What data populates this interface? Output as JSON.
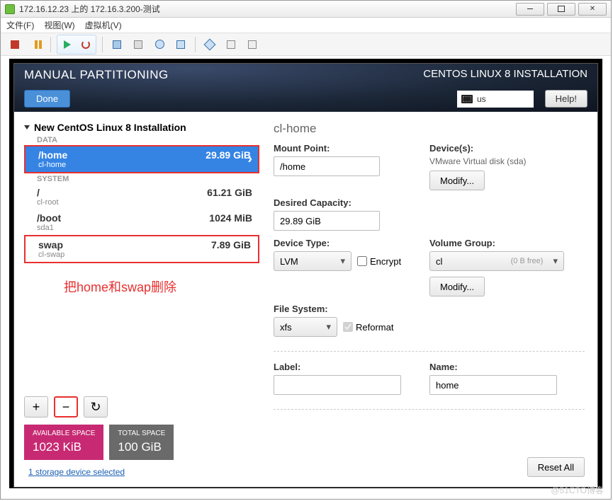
{
  "window": {
    "title": "172.16.12.23 上的 172.16.3.200-测试"
  },
  "menu": {
    "file": "文件(F)",
    "view": "视图(W)",
    "vm": "虚拟机(V)"
  },
  "installer": {
    "title": "MANUAL PARTITIONING",
    "product": "CENTOS LINUX 8 INSTALLATION",
    "done": "Done",
    "help": "Help!",
    "kb": "us"
  },
  "tree": {
    "header": "New CentOS Linux 8 Installation",
    "data_label": "DATA",
    "system_label": "SYSTEM",
    "home": {
      "mp": "/home",
      "size": "29.89 GiB",
      "dev": "cl-home"
    },
    "root": {
      "mp": "/",
      "size": "61.21 GiB",
      "dev": "cl-root"
    },
    "boot": {
      "mp": "/boot",
      "size": "1024 MiB",
      "dev": "sda1"
    },
    "swap": {
      "mp": "swap",
      "size": "7.89 GiB",
      "dev": "cl-swap"
    }
  },
  "annotation": "把home和swap删除",
  "space": {
    "avail_lbl": "AVAILABLE SPACE",
    "avail_val": "1023 KiB",
    "total_lbl": "TOTAL SPACE",
    "total_val": "100 GiB"
  },
  "storage_link": "1 storage device selected",
  "detail": {
    "title": "cl-home",
    "mount_lbl": "Mount Point:",
    "mount_val": "/home",
    "cap_lbl": "Desired Capacity:",
    "cap_val": "29.89 GiB",
    "devs_lbl": "Device(s):",
    "devs_val": "VMware Virtual disk (sda)",
    "modify": "Modify...",
    "dtype_lbl": "Device Type:",
    "dtype_val": "LVM",
    "encrypt": "Encrypt",
    "vg_lbl": "Volume Group:",
    "vg_val": "cl",
    "vg_free": "(0 B free)",
    "fs_lbl": "File System:",
    "fs_val": "xfs",
    "reformat": "Reformat",
    "label_lbl": "Label:",
    "label_val": "",
    "name_lbl": "Name:",
    "name_val": "home",
    "reset": "Reset All"
  },
  "watermark": "@51CTO博客"
}
